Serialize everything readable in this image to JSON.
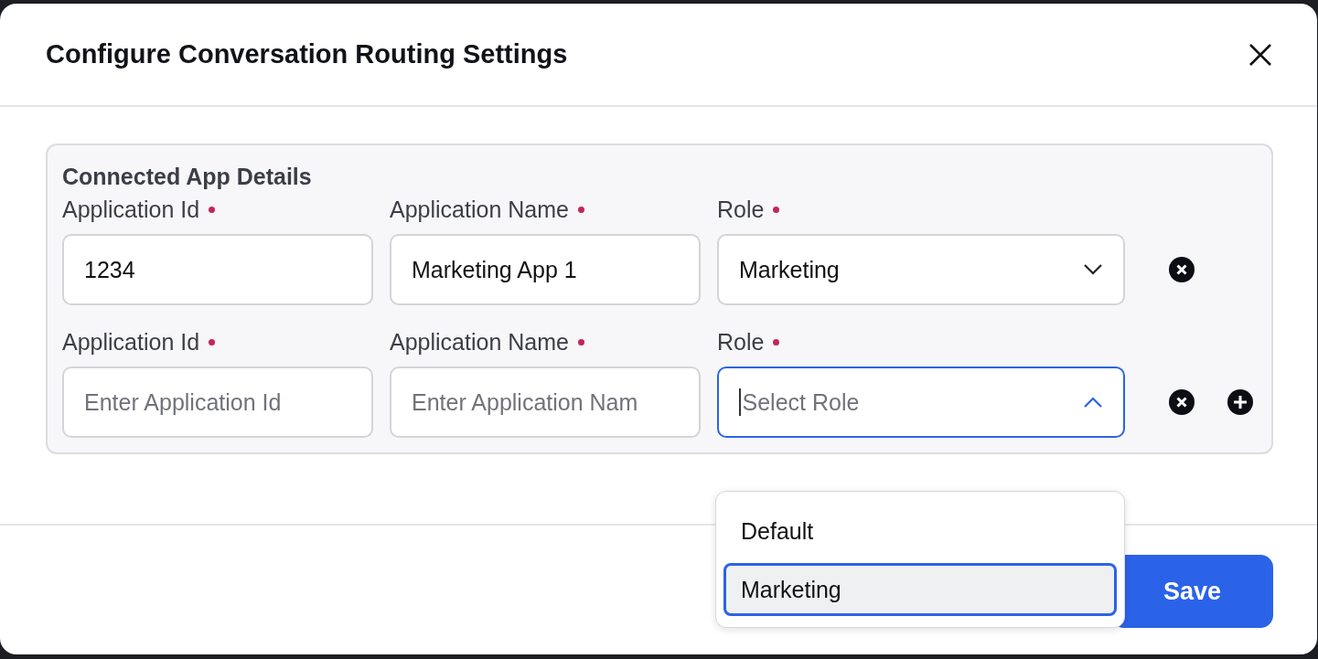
{
  "dialog": {
    "title": "Configure Conversation Routing Settings"
  },
  "section": {
    "title": "Connected App Details",
    "rows": [
      {
        "fields": [
          {
            "kind": "text",
            "label": "Application Id",
            "required": true,
            "value": "1234"
          },
          {
            "kind": "text",
            "label": "Application Name",
            "required": true,
            "value": "Marketing App 1"
          },
          {
            "kind": "select",
            "label": "Role",
            "required": true,
            "value": "Marketing",
            "open": false
          }
        ],
        "can_add": false
      },
      {
        "fields": [
          {
            "kind": "text",
            "label": "Application Id",
            "required": true,
            "placeholder": "Enter Application Id"
          },
          {
            "kind": "text",
            "label": "Application Name",
            "required": true,
            "placeholder": "Enter Application Nam"
          },
          {
            "kind": "select",
            "label": "Role",
            "required": true,
            "placeholder": "Select Role",
            "open": true
          }
        ],
        "can_add": true
      }
    ]
  },
  "dropdown": {
    "options": [
      {
        "label": "Default",
        "selected": false
      },
      {
        "label": "Marketing",
        "selected": true
      }
    ]
  },
  "footer": {
    "save": "Save"
  }
}
